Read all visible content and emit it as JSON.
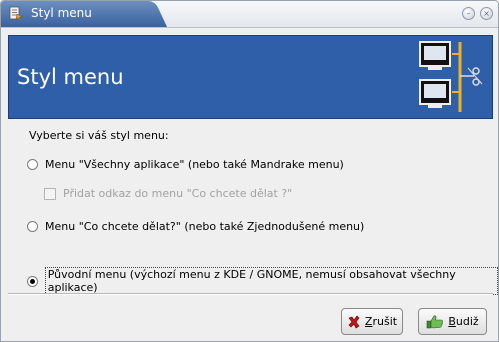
{
  "window": {
    "title": "Styl menu",
    "icons": [
      "menu-editor-app-icon",
      "minimize-icon",
      "close-icon"
    ]
  },
  "banner": {
    "heading": "Styl menu",
    "art_icon": "monitors-network-icon"
  },
  "prompt": "Vyberte si váš styl menu:",
  "options": [
    {
      "label": "Menu \"Všechny aplikace\" (nebo také Mandrake menu)",
      "selected": false
    },
    {
      "label": "Menu \"Co chcete dělat?\" (nebo také Zjednodušené menu)",
      "selected": false
    },
    {
      "label": "Původní menu (výchozí menu z KDE / GNOME, nemusí obsahovat všechny aplikace)",
      "selected": true
    }
  ],
  "sub_checkbox": {
    "label": "Přidat odkaz do menu \"Co chcete dělat ?\"",
    "checked": false,
    "enabled": false
  },
  "buttons": {
    "cancel": {
      "mnemonic": "Z",
      "rest": "rušit",
      "icon": "cross-icon"
    },
    "ok": {
      "mnemonic": "B",
      "rest": "udiž",
      "icon": "thumbs-up-icon"
    }
  },
  "colors": {
    "banner": "#2e5fa8",
    "title_tab": "#3a62a0"
  }
}
